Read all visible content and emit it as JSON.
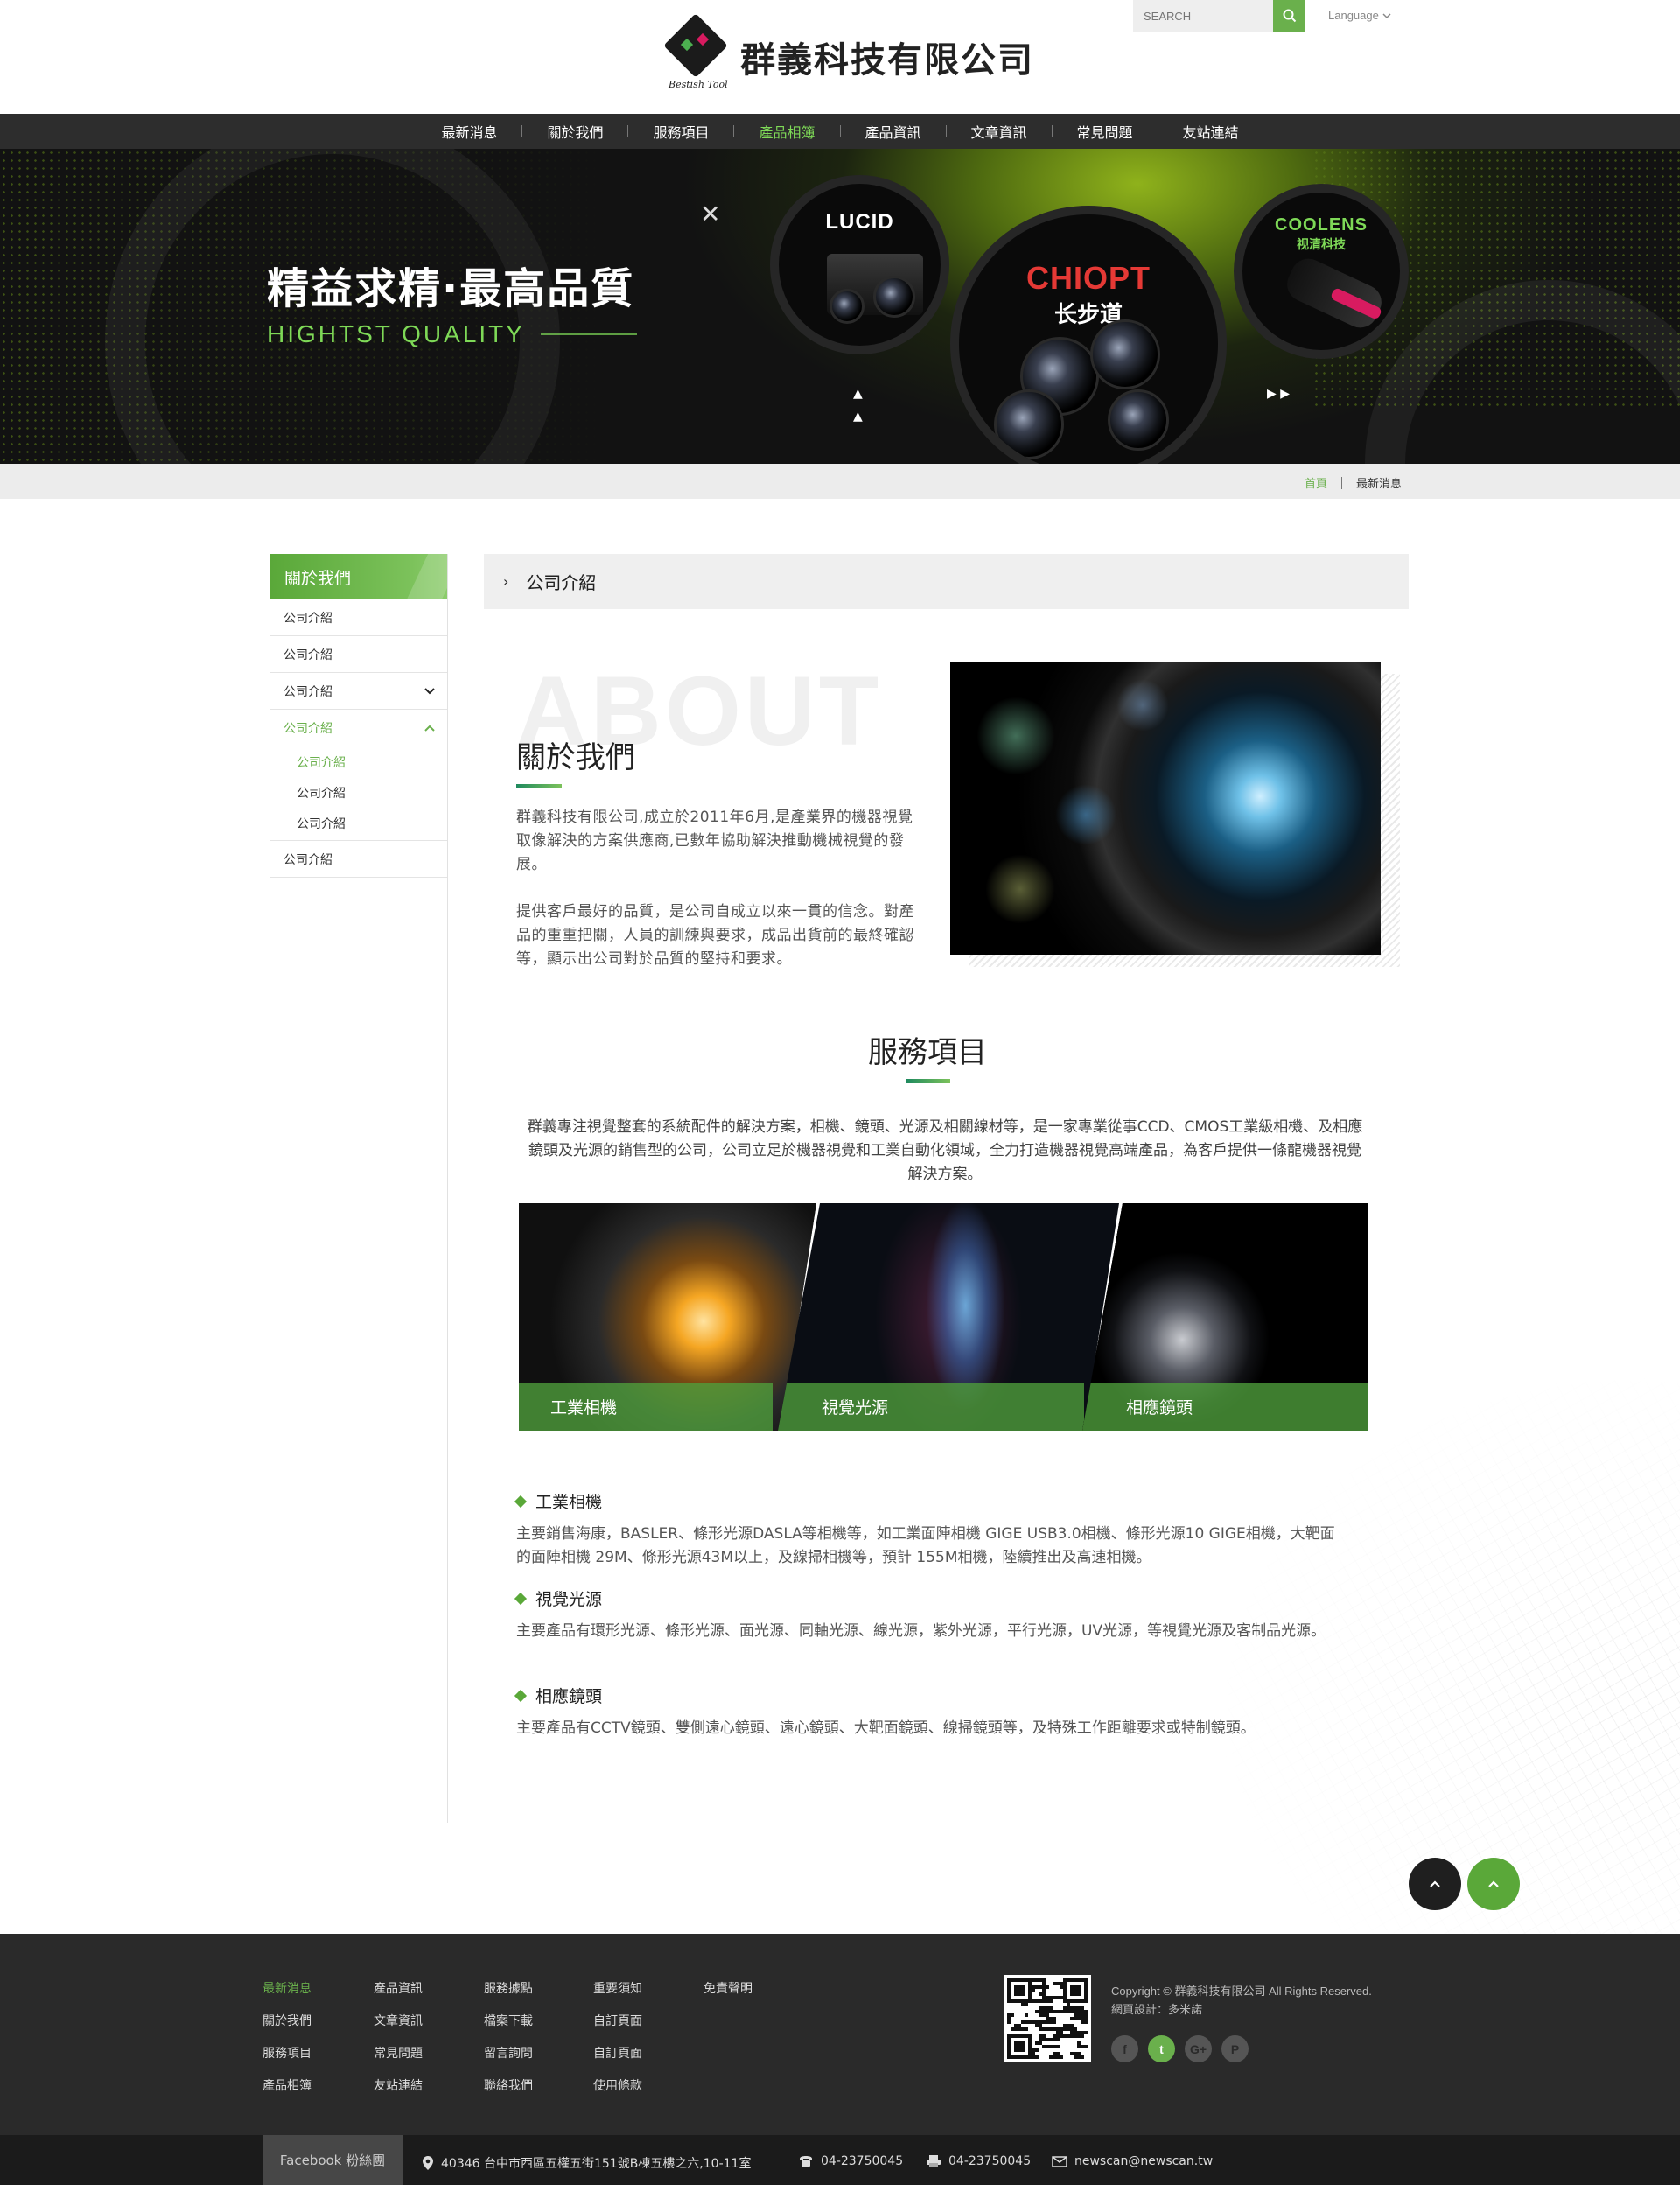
{
  "header": {
    "company_name": "群義科技有限公司",
    "logo_signature": "Bestish Tool",
    "search_placeholder": "SEARCH",
    "language_label": "Language"
  },
  "nav": {
    "items": [
      "最新消息",
      "關於我們",
      "服務項目",
      "產品相簿",
      "產品資訊",
      "文章資訊",
      "常見問題",
      "友站連結"
    ],
    "active_index": 3
  },
  "banner": {
    "title": "精益求精·最高品質",
    "subtitle": "HIGHTST QUALITY",
    "brands": [
      {
        "name": "LUCID",
        "color": "#ffffff"
      },
      {
        "name": "CHIOPT",
        "sub": "长步道",
        "color": "#e53935"
      },
      {
        "name": "COOLENS",
        "sub": "视清科技",
        "color": "#7ed957"
      }
    ]
  },
  "breadcrumb": {
    "home": "首頁",
    "current": "最新消息"
  },
  "sidebar": {
    "title": "關於我們",
    "items": [
      {
        "label": "公司介紹"
      },
      {
        "label": "公司介紹"
      },
      {
        "label": "公司介紹",
        "expand": "down"
      },
      {
        "label": "公司介紹",
        "expand": "up",
        "active": true,
        "children": [
          "公司介紹",
          "公司介紹",
          "公司介紹"
        ]
      },
      {
        "label": "公司介紹"
      }
    ]
  },
  "main": {
    "section_title": "公司介紹",
    "about": {
      "bg_word": "ABOUT",
      "title": "關於我們",
      "para1": "群義科技有限公司,成立於2011年6月,是產業界的機器視覺取像解決的方案供應商,已數年協助解決推動機械視覺的發展。",
      "para2": "提供客戶最好的品質，是公司自成立以來一貫的信念。對產品的重重把關，人員的訓練與要求，成品出貨前的最終確認等，顯示出公司對於品質的堅持和要求。"
    },
    "services": {
      "title": "服務項目",
      "desc": "群義專注視覺整套的系統配件的解決方案，相機、鏡頭、光源及相關線材等，是一家專業從事CCD、CMOS工業級相機、及相應鏡頭及光源的銷售型的公司，公司立足於機器視覺和工業自動化領域，全力打造機器視覺高端產品，為客戶提供一條龍機器視覺解決方案。",
      "panels": [
        "工業相機",
        "視覺光源",
        "相應鏡頭"
      ],
      "items": [
        {
          "title": "工業相機",
          "text": "主要銷售海康，BASLER、條形光源DASLA等相機等，如工業面陣相機 GIGE USB3.0相機、條形光源10 GIGE相機，大靶面的面陣相機 29M、條形光源43M以上，及線掃相機等，預計 155M相機，陸續推出及高速相機。"
        },
        {
          "title": "視覺光源",
          "text": "主要產品有環形光源、條形光源、面光源、同軸光源、線光源，紫外光源，平行光源，UV光源，等視覺光源及客制品光源。"
        },
        {
          "title": "相應鏡頭",
          "text": "主要產品有CCTV鏡頭、雙側遠心鏡頭、遠心鏡頭、大靶面鏡頭、線掃鏡頭等，及特殊工作距離要求或特制鏡頭。"
        }
      ]
    }
  },
  "footer": {
    "columns": [
      [
        "最新消息",
        "關於我們",
        "服務項目",
        "產品相簿"
      ],
      [
        "產品資訊",
        "文章資訊",
        "常見問題",
        "友站連結"
      ],
      [
        "服務據點",
        "檔案下載",
        "留言詢問",
        "聯絡我們"
      ],
      [
        "重要須知",
        "自訂頁面",
        "自訂頁面",
        "使用條款"
      ],
      [
        "免責聲明"
      ]
    ],
    "copyright": "Copyright © 群義科技有限公司 All Rights Reserved.",
    "design": "網頁設計：多米諾",
    "social": [
      "f",
      "t",
      "G+",
      "P"
    ],
    "facebook_label": "Facebook 粉絲團",
    "address": "40346 台中市西區五權五街151號B棟五樓之六,10-11室",
    "phone": "04-23750045",
    "fax": "04-23750045",
    "email": "newscan@newscan.tw"
  },
  "colors": {
    "accent": "#6ab04c",
    "nav_bg": "#2d2d2d",
    "footer_bg": "#2a2a2a"
  }
}
